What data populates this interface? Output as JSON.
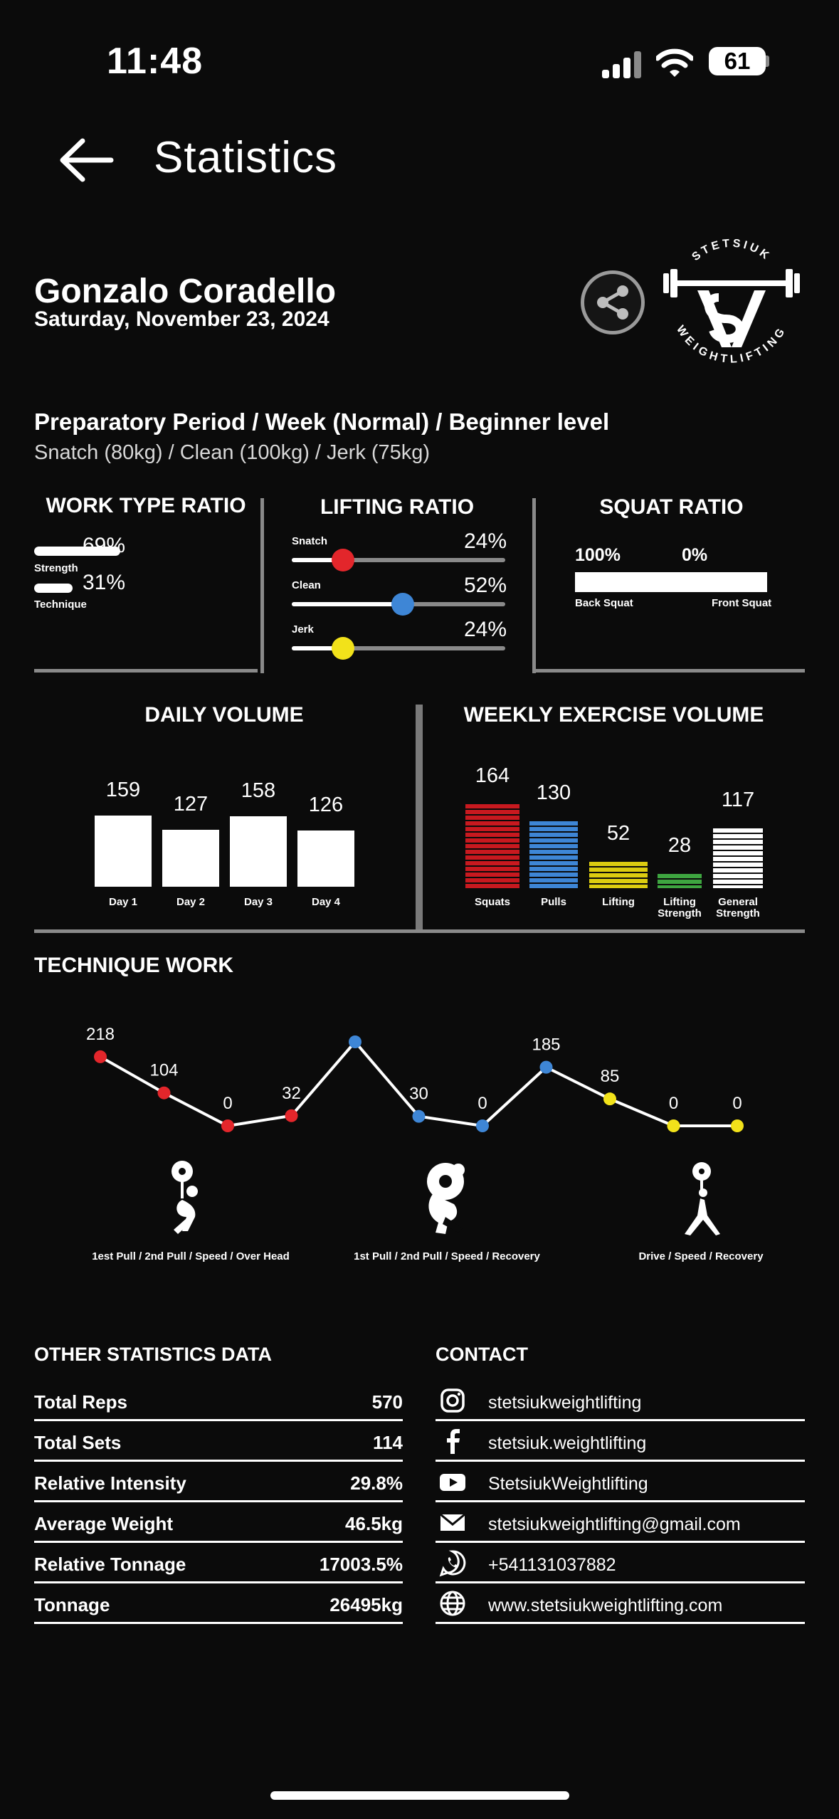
{
  "status_bar": {
    "time": "11:48",
    "battery": "61"
  },
  "header": {
    "title": "Statistics",
    "back_icon": "arrow-left-icon"
  },
  "user": {
    "name": "Gonzalo Coradello",
    "date": "Saturday, November 23, 2024"
  },
  "logo": {
    "text_top": "STETSIUK",
    "text_bottom": "WEIGHTLIFTING"
  },
  "program": {
    "title": "Preparatory Period / Week (Normal) / Beginner level",
    "maxes": "Snatch (80kg) / Clean (100kg) / Jerk (75kg)"
  },
  "work_type": {
    "title": "WORK TYPE RATIO",
    "items": [
      {
        "label": "Strength",
        "value": "69%",
        "fraction": 0.69
      },
      {
        "label": "Technique",
        "value": "31%",
        "fraction": 0.31
      }
    ]
  },
  "lifting_ratio": {
    "title": "LIFTING RATIO",
    "items": [
      {
        "label": "Snatch",
        "value": "24%",
        "fraction": 0.24,
        "color": "#e3262b"
      },
      {
        "label": "Clean",
        "value": "52%",
        "fraction": 0.52,
        "color": "#3e86d6"
      },
      {
        "label": "Jerk",
        "value": "24%",
        "fraction": 0.24,
        "color": "#f2e21a"
      }
    ]
  },
  "squat_ratio": {
    "title": "SQUAT RATIO",
    "back_value": "100%",
    "front_value": "0%",
    "back_label": "Back Squat",
    "front_label": "Front Squat",
    "back_fraction": 1.0
  },
  "daily_volume": {
    "title": "DAILY VOLUME",
    "chart_data": {
      "type": "bar",
      "categories": [
        "Day 1",
        "Day 2",
        "Day 3",
        "Day 4"
      ],
      "values": [
        159,
        127,
        158,
        126
      ]
    }
  },
  "weekly_volume": {
    "title": "WEEKLY EXERCISE VOLUME",
    "chart_data": {
      "type": "bar",
      "categories": [
        "Squats",
        "Pulls",
        "Lifting",
        "Lifting Strength",
        "General Strength"
      ],
      "values": [
        164,
        130,
        52,
        28,
        117
      ],
      "colors": [
        "#c8191f",
        "#3e86d6",
        "#dccc10",
        "#3ea640",
        "#ffffff"
      ]
    }
  },
  "technique": {
    "title": "TECHNIQUE WORK",
    "chart_data": {
      "type": "line",
      "values": [
        218,
        104,
        0,
        32,
        265,
        30,
        0,
        185,
        85,
        0,
        0
      ],
      "groups": [
        {
          "label": "1est Pull / 2nd Pull / Speed / Over Head",
          "color": "#e3262b",
          "count": 4
        },
        {
          "label": "1st Pull / 2nd Pull / Speed / Recovery",
          "color": "#3e86d6",
          "count": 4
        },
        {
          "label": "Drive / Speed / Recovery",
          "color": "#f2e21a",
          "count": 3
        }
      ]
    },
    "icons": [
      "snatch-athlete-icon",
      "clean-athlete-icon",
      "jerk-athlete-icon"
    ]
  },
  "other_stats": {
    "title": "OTHER STATISTICS DATA",
    "rows": [
      {
        "label": "Total Reps",
        "value": "570"
      },
      {
        "label": "Total Sets",
        "value": "114"
      },
      {
        "label": "Relative Intensity",
        "value": "29.8%"
      },
      {
        "label": "Average Weight",
        "value": "46.5kg"
      },
      {
        "label": "Relative Tonnage",
        "value": "17003.5%"
      },
      {
        "label": "Tonnage",
        "value": "26495kg"
      }
    ]
  },
  "contact": {
    "title": "CONTACT",
    "rows": [
      {
        "icon": "instagram-icon",
        "text": "stetsiukweightlifting"
      },
      {
        "icon": "facebook-icon",
        "text": "stetsiuk.weightlifting"
      },
      {
        "icon": "youtube-icon",
        "text": "StetsiukWeightlifting"
      },
      {
        "icon": "mail-icon",
        "text": "stetsiukweightlifting@gmail.com"
      },
      {
        "icon": "whatsapp-icon",
        "text": "+541131037882"
      },
      {
        "icon": "globe-icon",
        "text": "www.stetsiukweightlifting.com"
      }
    ]
  }
}
